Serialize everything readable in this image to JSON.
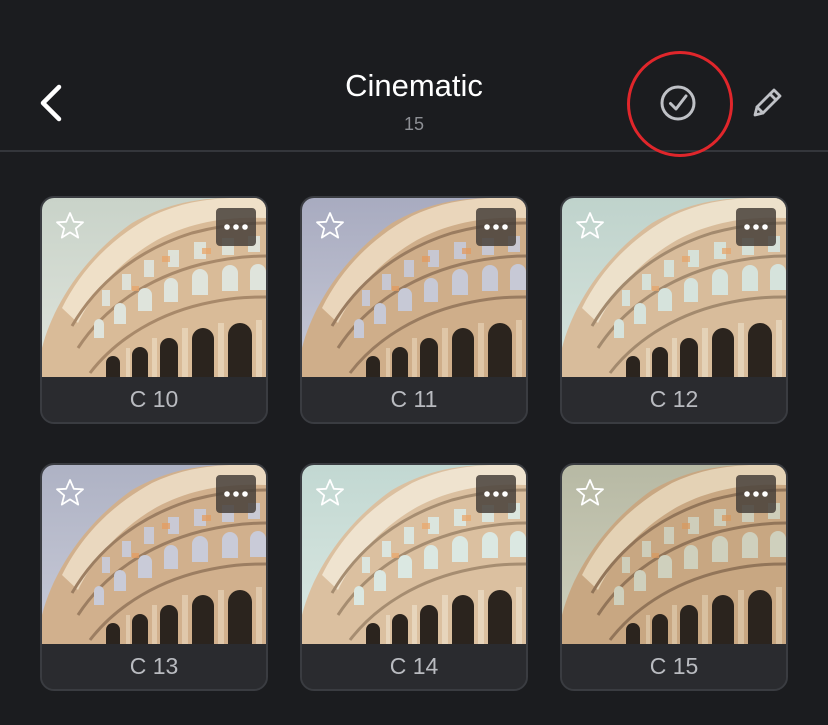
{
  "header": {
    "title": "Cinematic",
    "count": "15",
    "back_icon": "chevron-left-icon",
    "select_icon": "check-circle-icon",
    "edit_icon": "pencil-icon",
    "highlight_color": "#e0262b"
  },
  "presets": [
    {
      "label": "C 10",
      "tint": {
        "sky_top": "#c9d3c9",
        "sky_bottom": "#dfe4dc",
        "stone_light": "#efe0c8",
        "stone_mid": "#d9bb98",
        "stone_dark": "#a8896a",
        "accent": "#e8a56a"
      }
    },
    {
      "label": "C 11",
      "tint": {
        "sky_top": "#a8abc0",
        "sky_bottom": "#c7c9d6",
        "stone_light": "#ead6bb",
        "stone_mid": "#cfae8a",
        "stone_dark": "#9a7c60",
        "accent": "#e39a5f"
      }
    },
    {
      "label": "C 12",
      "tint": {
        "sky_top": "#bfd3cc",
        "sky_bottom": "#d6e3dc",
        "stone_light": "#ede1cb",
        "stone_mid": "#d8bc9b",
        "stone_dark": "#a38a6e",
        "accent": "#e6a66c"
      }
    },
    {
      "label": "C 13",
      "tint": {
        "sky_top": "#aeb2c4",
        "sky_bottom": "#c9cbd8",
        "stone_light": "#ead8bf",
        "stone_mid": "#d1b08d",
        "stone_dark": "#9c7e62",
        "accent": "#e69d60"
      }
    },
    {
      "label": "C 14",
      "tint": {
        "sky_top": "#c2d8d2",
        "sky_bottom": "#dbe8e2",
        "stone_light": "#efe3cf",
        "stone_mid": "#dbc0a0",
        "stone_dark": "#a68d71",
        "accent": "#eaa86d"
      }
    },
    {
      "label": "C 15",
      "tint": {
        "sky_top": "#b7b9a4",
        "sky_bottom": "#cfd0bd",
        "stone_light": "#e4d2b5",
        "stone_mid": "#c8a782",
        "stone_dark": "#927559",
        "accent": "#d99a60"
      }
    }
  ],
  "icons": {
    "favorite": "star-outline-icon",
    "more": "more-dots-icon"
  }
}
